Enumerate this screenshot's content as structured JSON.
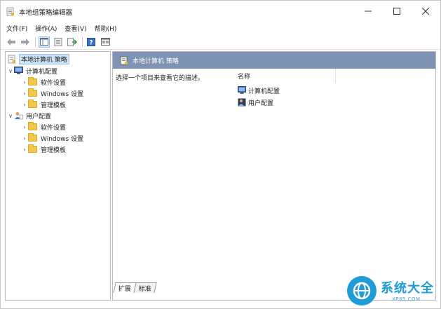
{
  "window": {
    "title": "本地组策略编辑器",
    "controls": {
      "minimize": "—",
      "maximize": "☐",
      "close": "✕"
    }
  },
  "menu": [
    "文件(F)",
    "操作(A)",
    "查看(V)",
    "帮助(H)"
  ],
  "toolbar": {
    "buttons": [
      "back-icon",
      "forward-icon",
      "show-hide-tree-icon",
      "properties-icon",
      "export-list-icon",
      "help-icon",
      "console-icon"
    ]
  },
  "tree": {
    "root": "本地计算机 策略",
    "computer_config": "计算机配置",
    "computer_children": [
      "软件设置",
      "Windows 设置",
      "管理模板"
    ],
    "user_config": "用户配置",
    "user_children": [
      "软件设置",
      "Windows 设置",
      "管理模板"
    ]
  },
  "main": {
    "header": "本地计算机 策略",
    "description": "选择一个项目来查看它的描述。",
    "column_name": "名称",
    "items": [
      "计算机配置",
      "用户配置"
    ]
  },
  "tabs": [
    "扩展",
    "标准"
  ],
  "watermark": {
    "brand": "系统大全",
    "url": "XP85.COM"
  },
  "colors": {
    "pane_header": "#7f93b4",
    "selection": "#cfe3f7",
    "folder": "#f2c94c",
    "watermark_blue": "#1f9bd8"
  }
}
